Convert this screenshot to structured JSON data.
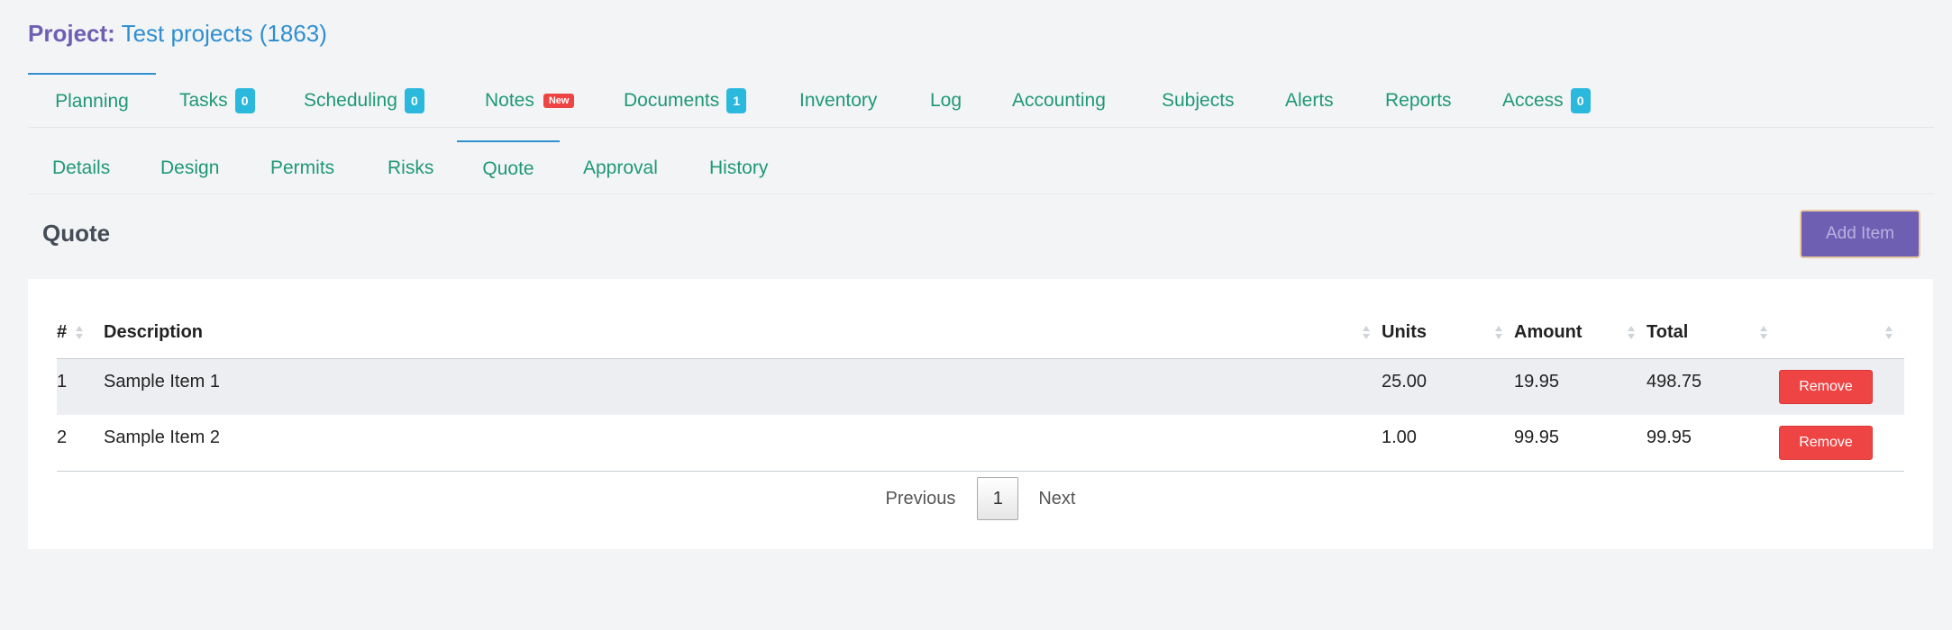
{
  "project": {
    "label": "Project:",
    "name": "Test projects (1863)"
  },
  "primary_tabs": [
    {
      "label": "Planning",
      "badge": "",
      "active": true
    },
    {
      "label": "Tasks",
      "badge": "0"
    },
    {
      "label": "Scheduling",
      "badge": "0"
    },
    {
      "label": "Notes",
      "new": "New"
    },
    {
      "label": "Documents",
      "badge": "1"
    },
    {
      "label": "Inventory"
    },
    {
      "label": "Log"
    },
    {
      "label": "Accounting"
    },
    {
      "label": "Subjects"
    },
    {
      "label": "Alerts"
    },
    {
      "label": "Reports"
    },
    {
      "label": "Access",
      "badge": "0"
    }
  ],
  "secondary_tabs": [
    {
      "label": "Details"
    },
    {
      "label": "Design"
    },
    {
      "label": "Permits"
    },
    {
      "label": "Risks"
    },
    {
      "label": "Quote",
      "active": true
    },
    {
      "label": "Approval"
    },
    {
      "label": "History"
    }
  ],
  "section": {
    "title": "Quote",
    "add_button": "Add Item"
  },
  "table": {
    "headers": {
      "num": "#",
      "description": "Description",
      "units": "Units",
      "amount": "Amount",
      "total": "Total"
    },
    "rows": [
      {
        "num": "1",
        "description": "Sample Item 1",
        "units": "25.00",
        "amount": "19.95",
        "total": "498.75",
        "action": "Remove"
      },
      {
        "num": "2",
        "description": "Sample Item 2",
        "units": "1.00",
        "amount": "99.95",
        "total": "99.95",
        "action": "Remove"
      }
    ]
  },
  "pagination": {
    "previous": "Previous",
    "current": "1",
    "next": "Next"
  },
  "colors": {
    "accent": "#6f5fb3",
    "link": "#1f9876",
    "badge": "#2bb8dd",
    "danger": "#ef4444"
  }
}
